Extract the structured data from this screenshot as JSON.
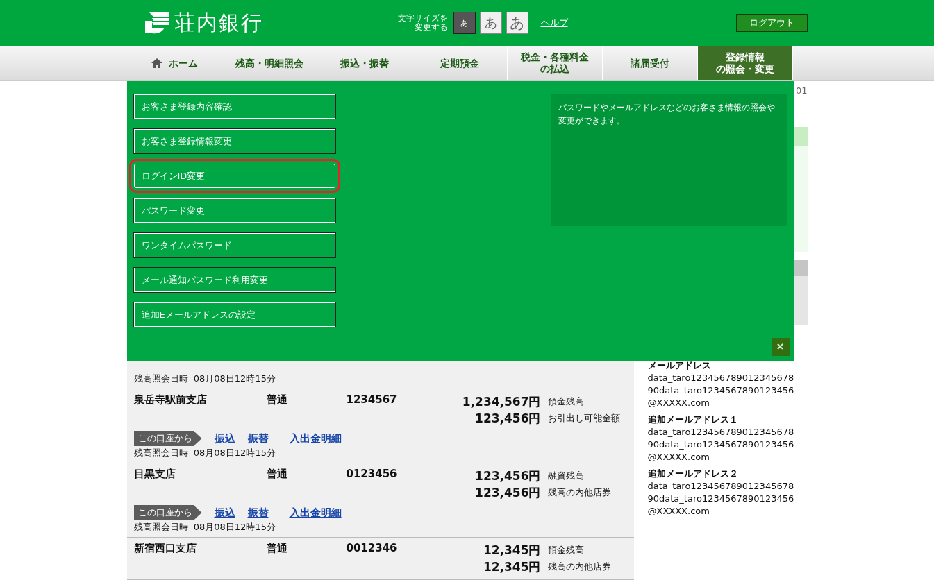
{
  "header": {
    "logo": "荘内銀行",
    "font_size_label": [
      "文字サイズを",
      "変更する"
    ],
    "font_sizes": [
      {
        "label": "あ",
        "selected": true
      },
      {
        "label": "あ",
        "selected": false
      },
      {
        "label": "あ",
        "selected": false
      }
    ],
    "help": "ヘルプ",
    "logout": "ログアウト"
  },
  "nav": [
    {
      "label": "ホーム",
      "selected": false
    },
    {
      "label": "残高・明細照会",
      "selected": false
    },
    {
      "label": "振込・振替",
      "selected": false
    },
    {
      "label": "定期預金",
      "selected": false
    },
    {
      "label": "税金・各種料金",
      "label_2": "の払込",
      "selected": false
    },
    {
      "label": "諸届受付",
      "selected": false
    },
    {
      "label": "登録情報",
      "label_2": "の照会・変更",
      "selected": true
    }
  ],
  "dropdown": {
    "items": [
      {
        "label": "お客さま登録内容確認",
        "highlighted": false
      },
      {
        "label": "お客さま登録情報変更",
        "highlighted": false
      },
      {
        "label": "ログインID変更",
        "highlighted": true
      },
      {
        "label": "パスワード変更",
        "highlighted": false
      },
      {
        "label": "ワンタイムパスワード",
        "highlighted": false
      },
      {
        "label": "メール通知パスワード利用変更",
        "highlighted": false
      },
      {
        "label": "追加Eメールアドレスの設定",
        "highlighted": false
      }
    ],
    "description": "パスワードやメールアドレスなどのお客さま情報の照会や変更ができます。",
    "close": "×"
  },
  "partial_time": "残高照会日時  08月08日12時15分",
  "accounts": [
    {
      "branch": "泉岳寺駅前支店",
      "type": "普通",
      "number": "1234567",
      "amounts": [
        {
          "amount": "1,234,567円",
          "caption": "預金残高"
        },
        {
          "amount": "123,456円",
          "caption": "お引出し可能金額"
        }
      ],
      "from_label": "この口座から",
      "links": [
        "振込",
        "振替",
        "入出金明細"
      ],
      "time": "残高照会日時  08月08日12時15分"
    },
    {
      "branch": "目黒支店",
      "type": "普通",
      "number": "0123456",
      "amounts": [
        {
          "amount": "123,456円",
          "caption": "融資残高"
        },
        {
          "amount": "123,456円",
          "caption": "残高の内他店券"
        }
      ],
      "from_label": "この口座から",
      "links": [
        "振込",
        "振替",
        "入出金明細"
      ],
      "time": "残高照会日時  08月08日12時15分"
    },
    {
      "branch": "新宿西口支店",
      "type": "普通",
      "number": "0012346",
      "amounts": [
        {
          "amount": "12,345円",
          "caption": "預金残高"
        },
        {
          "amount": "12,345円",
          "caption": "残高の内他店券"
        }
      ]
    }
  ],
  "side": {
    "fragment": "01",
    "emails": [
      {
        "title": "メールアドレス",
        "lines": [
          "data_taro123456789012345678",
          "90data_taro1234567890123456",
          "@XXXXX.com"
        ]
      },
      {
        "title": "追加メールアドレス１",
        "lines": [
          "data_taro123456789012345678",
          "90data_taro1234567890123456",
          "@XXXXX.com"
        ]
      },
      {
        "title": "追加メールアドレス２",
        "lines": [
          "data_taro123456789012345678",
          "90data_taro1234567890123456",
          "@XXXXX.com"
        ]
      }
    ]
  }
}
